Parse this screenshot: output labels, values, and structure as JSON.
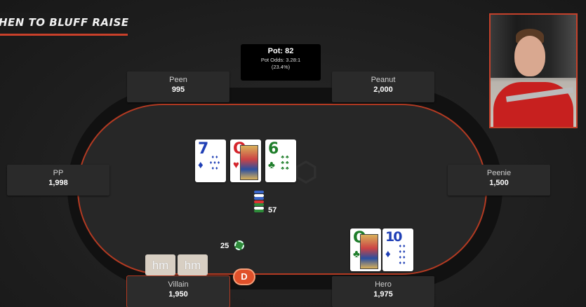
{
  "banner": {
    "title": "HEN TO BLUFF RAISE"
  },
  "pot": {
    "label": "Pot: 82",
    "odds": "Pot Odds: 3.28:1",
    "percent": "(23.4%)"
  },
  "seats": {
    "peen": {
      "name": "Peen",
      "stack": "995"
    },
    "peanut": {
      "name": "Peanut",
      "stack": "2,000"
    },
    "pp": {
      "name": "PP",
      "stack": "1,998"
    },
    "peenie": {
      "name": "Peenie",
      "stack": "1,500"
    },
    "villain": {
      "name": "Villain",
      "stack": "1,950"
    },
    "hero": {
      "name": "Hero",
      "stack": "1,975"
    }
  },
  "board": [
    {
      "rank": "7",
      "suit": "♦",
      "color": "blue"
    },
    {
      "rank": "Q",
      "suit": "♥",
      "color": "red"
    },
    {
      "rank": "6",
      "suit": "♣",
      "color": "green"
    }
  ],
  "hero_cards": [
    {
      "rank": "Q",
      "suit": "♣",
      "color": "green"
    },
    {
      "rank": "10",
      "suit": "♦",
      "color": "blue"
    }
  ],
  "bets": {
    "pot_chips": "57",
    "villain_bet": "25"
  },
  "villain_cards": {
    "left": "hm",
    "right": "hm"
  },
  "dealer_button": "D",
  "colors": {
    "accent": "#c9402a",
    "table": "#272727",
    "seat": "#2a2a2a"
  }
}
